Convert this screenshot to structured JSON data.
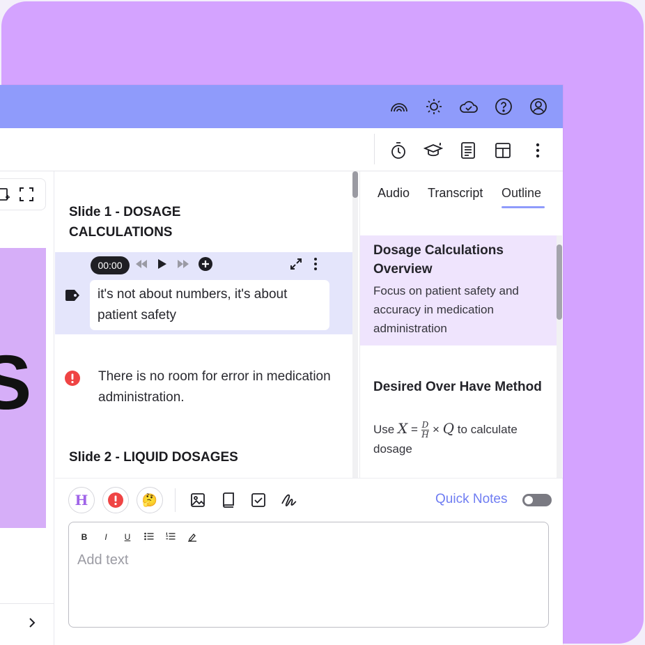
{
  "colors": {
    "accent": "#8f9bfb",
    "brand_purple": "#d4a3ff",
    "active_note_bg": "#e4e5fb",
    "outline_active_bg": "#efe4fd",
    "alert_red": "#ef4444",
    "quick_notes": "#6f7df2"
  },
  "topbar": {
    "icons": [
      "rainbow-icon",
      "sun-icon",
      "cloud-icon",
      "help-icon",
      "account-icon"
    ]
  },
  "toolbar": {
    "icons": [
      "timer-icon",
      "graduation-cap-icon",
      "document-icon",
      "layout-icon",
      "more-vertical-icon"
    ]
  },
  "left_pane": {
    "slide_glyph": "S",
    "icons": [
      "add-slide-icon",
      "fullscreen-icon",
      "chevron-right-icon"
    ]
  },
  "notes": {
    "slide1_title": "Slide 1 - DOSAGE CALCULATIONS",
    "player_time": "00:00",
    "note1_text": "it's not about numbers, it's about patient safety",
    "note2_text": "There is no room for error in medication administration.",
    "slide2_title": "Slide 2 - LIQUID DOSAGES"
  },
  "outline_panel": {
    "tabs": [
      "Audio",
      "Transcript",
      "Outline"
    ],
    "active_tab": "Outline",
    "items": [
      {
        "title": "Dosage Calculations Overview",
        "text": "Focus on patient safety and accuracy in medication administration"
      },
      {
        "title": "Desired Over Have Method",
        "text_prefix": "Use",
        "formula_lhs": "X",
        "formula_eq": "=",
        "formula_num": "D",
        "formula_den": "H",
        "formula_times": "×",
        "formula_rhs": "Q",
        "text_suffix": "to calculate dosage"
      }
    ]
  },
  "editor": {
    "emoji_buttons": [
      "H",
      "!",
      "🤔"
    ],
    "tool_icons": [
      "image-icon",
      "book-icon",
      "checkbox-icon",
      "signature-icon"
    ],
    "quick_notes_label": "Quick Notes",
    "quick_notes_on": false,
    "format_buttons": [
      "B",
      "I",
      "U",
      "bullet-list",
      "numbered-list",
      "highlight"
    ],
    "placeholder": "Add text"
  }
}
